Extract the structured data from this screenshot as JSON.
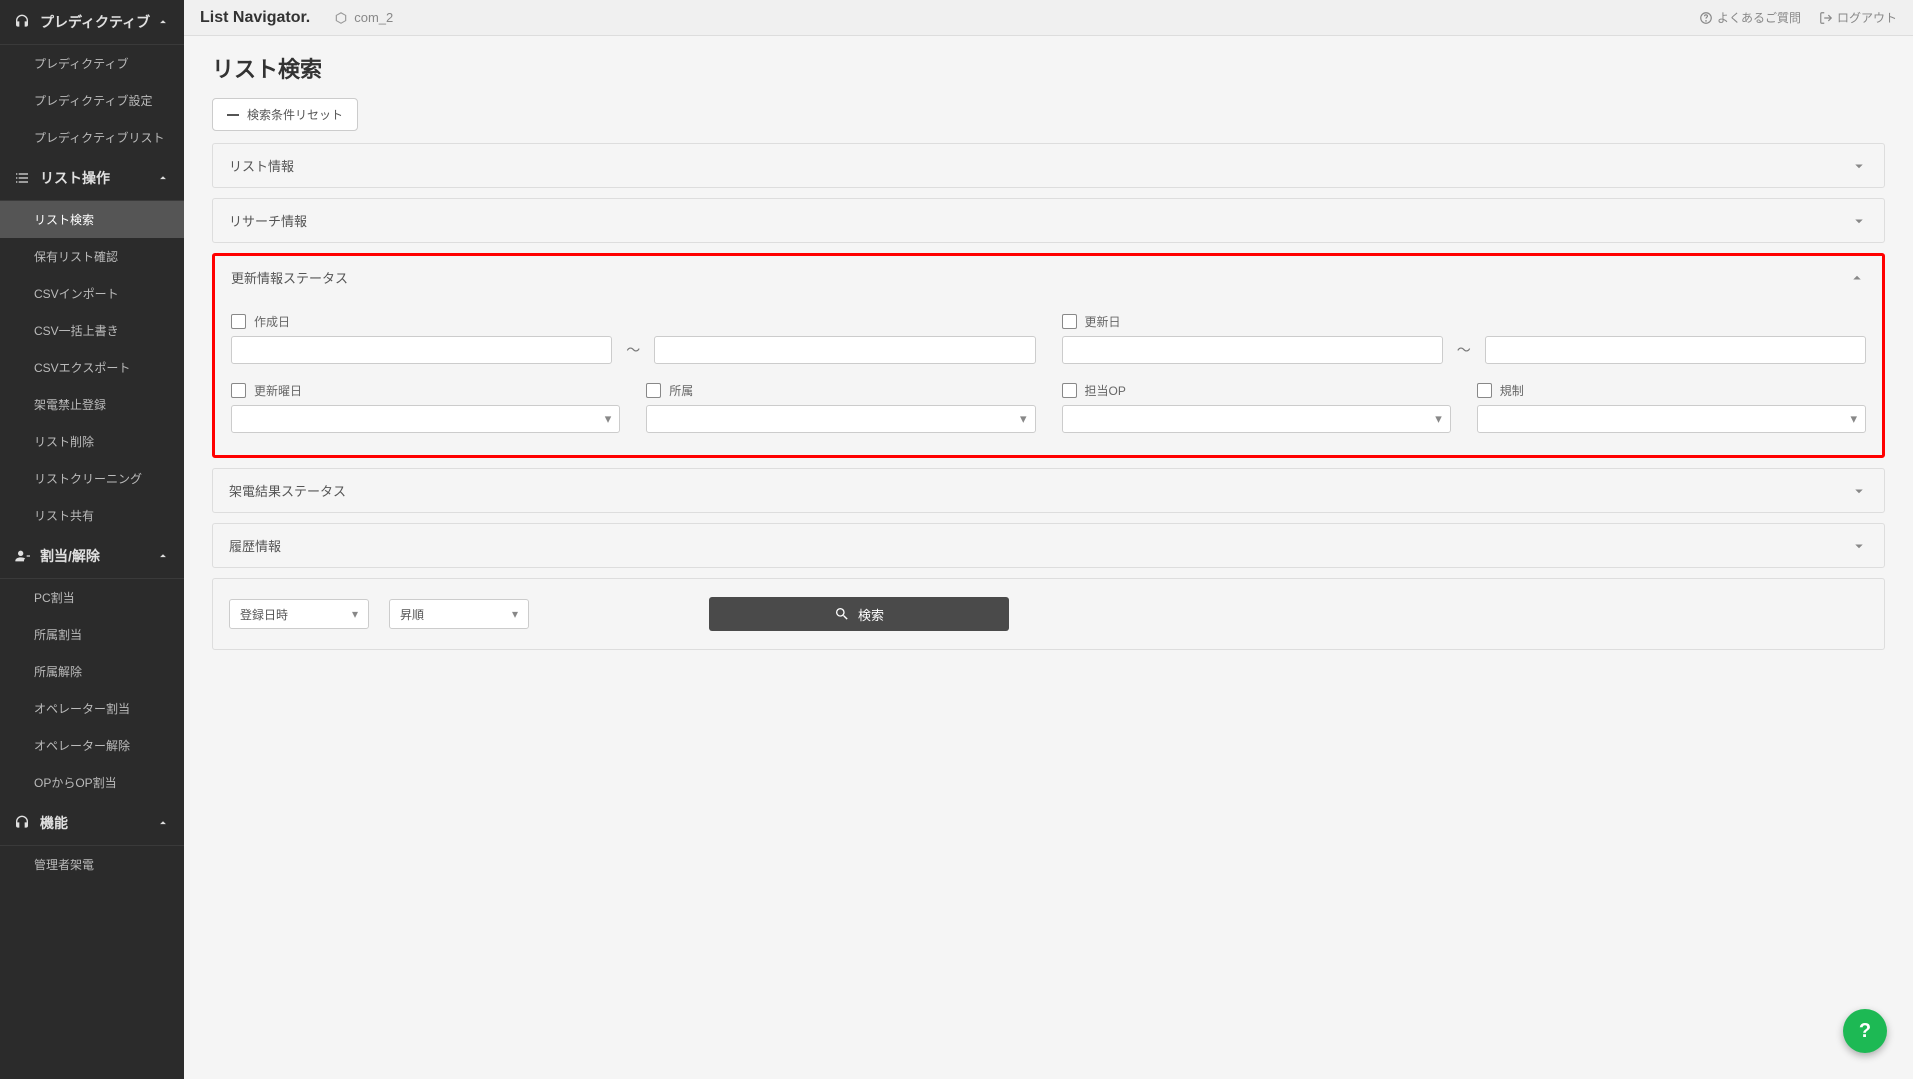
{
  "brand": "List Navigator.",
  "project": "com_2",
  "topbar": {
    "faq": "よくあるご質問",
    "logout": "ログアウト"
  },
  "sidebar": {
    "sections": [
      {
        "label": "プレディクティブ",
        "expanded": true,
        "items": [
          {
            "label": "プレディクティブ",
            "active": false
          },
          {
            "label": "プレディクティブ設定",
            "active": false
          },
          {
            "label": "プレディクティブリスト",
            "active": false
          }
        ]
      },
      {
        "label": "リスト操作",
        "expanded": true,
        "items": [
          {
            "label": "リスト検索",
            "active": true
          },
          {
            "label": "保有リスト確認",
            "active": false
          },
          {
            "label": "CSVインポート",
            "active": false
          },
          {
            "label": "CSV一括上書き",
            "active": false
          },
          {
            "label": "CSVエクスポート",
            "active": false
          },
          {
            "label": "架電禁止登録",
            "active": false
          },
          {
            "label": "リスト削除",
            "active": false
          },
          {
            "label": "リストクリーニング",
            "active": false
          },
          {
            "label": "リスト共有",
            "active": false
          }
        ]
      },
      {
        "label": "割当/解除",
        "expanded": true,
        "items": [
          {
            "label": "PC割当",
            "active": false
          },
          {
            "label": "所属割当",
            "active": false
          },
          {
            "label": "所属解除",
            "active": false
          },
          {
            "label": "オペレーター割当",
            "active": false
          },
          {
            "label": "オペレーター解除",
            "active": false
          },
          {
            "label": "OPからOP割当",
            "active": false
          }
        ]
      },
      {
        "label": "機能",
        "expanded": true,
        "items": [
          {
            "label": "管理者架電",
            "active": false
          }
        ]
      }
    ]
  },
  "page": {
    "title": "リスト検索",
    "reset_button": "検索条件リセット",
    "accordions": {
      "list_info": "リスト情報",
      "research_info": "リサーチ情報",
      "update_status": "更新情報ステータス",
      "call_result_status": "架電結果ステータス",
      "history_info": "履歴情報"
    },
    "update_status_panel": {
      "created_date": "作成日",
      "updated_date": "更新日",
      "range_sep": "～",
      "update_weekday": "更新曜日",
      "affiliation": "所属",
      "assigned_op": "担当OP",
      "regulation": "規制"
    },
    "sort": {
      "field": "登録日時",
      "order": "昇順"
    },
    "search_button": "検索"
  }
}
